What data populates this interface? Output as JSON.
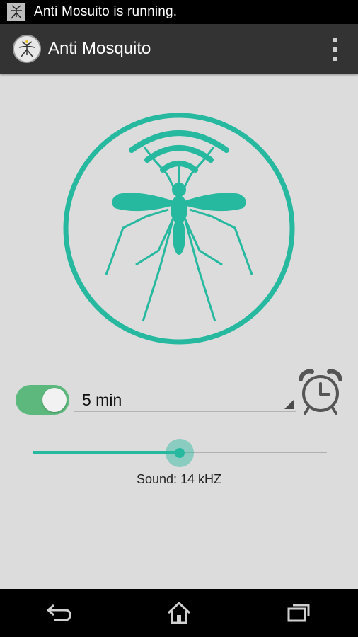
{
  "statusbar": {
    "notification": "Anti Mosuito is running.",
    "icon": "mosquito-icon"
  },
  "app": {
    "title": "Anti Mosquito",
    "icon": "mosquito-logo-icon",
    "menu_icon": "overflow-menu-icon"
  },
  "hero": {
    "icon": "mosquito-sound-icon",
    "accent": "#27b9a0"
  },
  "timer": {
    "enabled": true,
    "selected": "5 min",
    "alarm_icon": "alarm-clock-icon"
  },
  "sound": {
    "label": "Sound: 14 kHZ",
    "level": 0.5,
    "accent": "#27b9a0"
  },
  "navbar": {
    "icons": [
      "back-icon",
      "home-icon",
      "recent-apps-icon"
    ]
  }
}
